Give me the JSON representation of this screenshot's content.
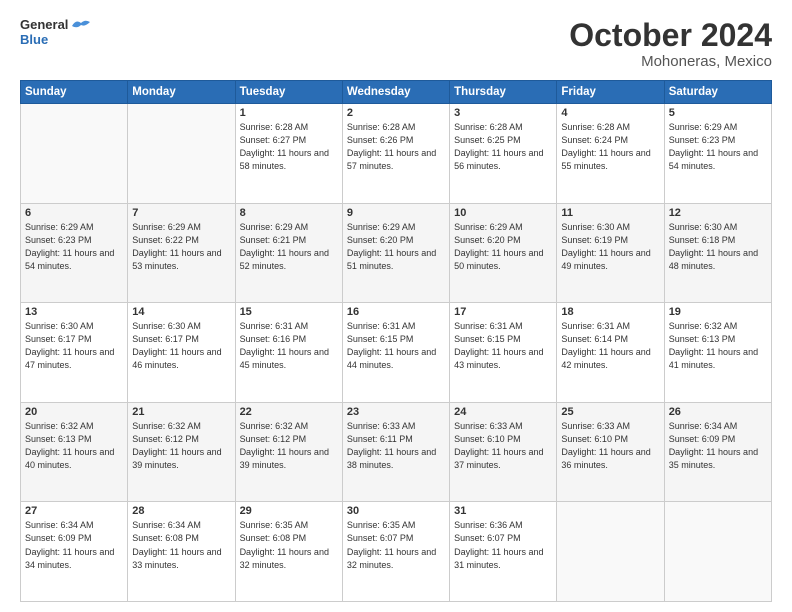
{
  "header": {
    "logo_line1": "General",
    "logo_line2": "Blue",
    "title": "October 2024",
    "subtitle": "Mohoneras, Mexico"
  },
  "weekdays": [
    "Sunday",
    "Monday",
    "Tuesday",
    "Wednesday",
    "Thursday",
    "Friday",
    "Saturday"
  ],
  "weeks": [
    {
      "days": [
        {
          "num": "",
          "info": ""
        },
        {
          "num": "",
          "info": ""
        },
        {
          "num": "1",
          "info": "Sunrise: 6:28 AM\nSunset: 6:27 PM\nDaylight: 11 hours\nand 58 minutes."
        },
        {
          "num": "2",
          "info": "Sunrise: 6:28 AM\nSunset: 6:26 PM\nDaylight: 11 hours\nand 57 minutes."
        },
        {
          "num": "3",
          "info": "Sunrise: 6:28 AM\nSunset: 6:25 PM\nDaylight: 11 hours\nand 56 minutes."
        },
        {
          "num": "4",
          "info": "Sunrise: 6:28 AM\nSunset: 6:24 PM\nDaylight: 11 hours\nand 55 minutes."
        },
        {
          "num": "5",
          "info": "Sunrise: 6:29 AM\nSunset: 6:23 PM\nDaylight: 11 hours\nand 54 minutes."
        }
      ]
    },
    {
      "days": [
        {
          "num": "6",
          "info": "Sunrise: 6:29 AM\nSunset: 6:23 PM\nDaylight: 11 hours\nand 54 minutes."
        },
        {
          "num": "7",
          "info": "Sunrise: 6:29 AM\nSunset: 6:22 PM\nDaylight: 11 hours\nand 53 minutes."
        },
        {
          "num": "8",
          "info": "Sunrise: 6:29 AM\nSunset: 6:21 PM\nDaylight: 11 hours\nand 52 minutes."
        },
        {
          "num": "9",
          "info": "Sunrise: 6:29 AM\nSunset: 6:20 PM\nDaylight: 11 hours\nand 51 minutes."
        },
        {
          "num": "10",
          "info": "Sunrise: 6:29 AM\nSunset: 6:20 PM\nDaylight: 11 hours\nand 50 minutes."
        },
        {
          "num": "11",
          "info": "Sunrise: 6:30 AM\nSunset: 6:19 PM\nDaylight: 11 hours\nand 49 minutes."
        },
        {
          "num": "12",
          "info": "Sunrise: 6:30 AM\nSunset: 6:18 PM\nDaylight: 11 hours\nand 48 minutes."
        }
      ]
    },
    {
      "days": [
        {
          "num": "13",
          "info": "Sunrise: 6:30 AM\nSunset: 6:17 PM\nDaylight: 11 hours\nand 47 minutes."
        },
        {
          "num": "14",
          "info": "Sunrise: 6:30 AM\nSunset: 6:17 PM\nDaylight: 11 hours\nand 46 minutes."
        },
        {
          "num": "15",
          "info": "Sunrise: 6:31 AM\nSunset: 6:16 PM\nDaylight: 11 hours\nand 45 minutes."
        },
        {
          "num": "16",
          "info": "Sunrise: 6:31 AM\nSunset: 6:15 PM\nDaylight: 11 hours\nand 44 minutes."
        },
        {
          "num": "17",
          "info": "Sunrise: 6:31 AM\nSunset: 6:15 PM\nDaylight: 11 hours\nand 43 minutes."
        },
        {
          "num": "18",
          "info": "Sunrise: 6:31 AM\nSunset: 6:14 PM\nDaylight: 11 hours\nand 42 minutes."
        },
        {
          "num": "19",
          "info": "Sunrise: 6:32 AM\nSunset: 6:13 PM\nDaylight: 11 hours\nand 41 minutes."
        }
      ]
    },
    {
      "days": [
        {
          "num": "20",
          "info": "Sunrise: 6:32 AM\nSunset: 6:13 PM\nDaylight: 11 hours\nand 40 minutes."
        },
        {
          "num": "21",
          "info": "Sunrise: 6:32 AM\nSunset: 6:12 PM\nDaylight: 11 hours\nand 39 minutes."
        },
        {
          "num": "22",
          "info": "Sunrise: 6:32 AM\nSunset: 6:12 PM\nDaylight: 11 hours\nand 39 minutes."
        },
        {
          "num": "23",
          "info": "Sunrise: 6:33 AM\nSunset: 6:11 PM\nDaylight: 11 hours\nand 38 minutes."
        },
        {
          "num": "24",
          "info": "Sunrise: 6:33 AM\nSunset: 6:10 PM\nDaylight: 11 hours\nand 37 minutes."
        },
        {
          "num": "25",
          "info": "Sunrise: 6:33 AM\nSunset: 6:10 PM\nDaylight: 11 hours\nand 36 minutes."
        },
        {
          "num": "26",
          "info": "Sunrise: 6:34 AM\nSunset: 6:09 PM\nDaylight: 11 hours\nand 35 minutes."
        }
      ]
    },
    {
      "days": [
        {
          "num": "27",
          "info": "Sunrise: 6:34 AM\nSunset: 6:09 PM\nDaylight: 11 hours\nand 34 minutes."
        },
        {
          "num": "28",
          "info": "Sunrise: 6:34 AM\nSunset: 6:08 PM\nDaylight: 11 hours\nand 33 minutes."
        },
        {
          "num": "29",
          "info": "Sunrise: 6:35 AM\nSunset: 6:08 PM\nDaylight: 11 hours\nand 32 minutes."
        },
        {
          "num": "30",
          "info": "Sunrise: 6:35 AM\nSunset: 6:07 PM\nDaylight: 11 hours\nand 32 minutes."
        },
        {
          "num": "31",
          "info": "Sunrise: 6:36 AM\nSunset: 6:07 PM\nDaylight: 11 hours\nand 31 minutes."
        },
        {
          "num": "",
          "info": ""
        },
        {
          "num": "",
          "info": ""
        }
      ]
    }
  ]
}
